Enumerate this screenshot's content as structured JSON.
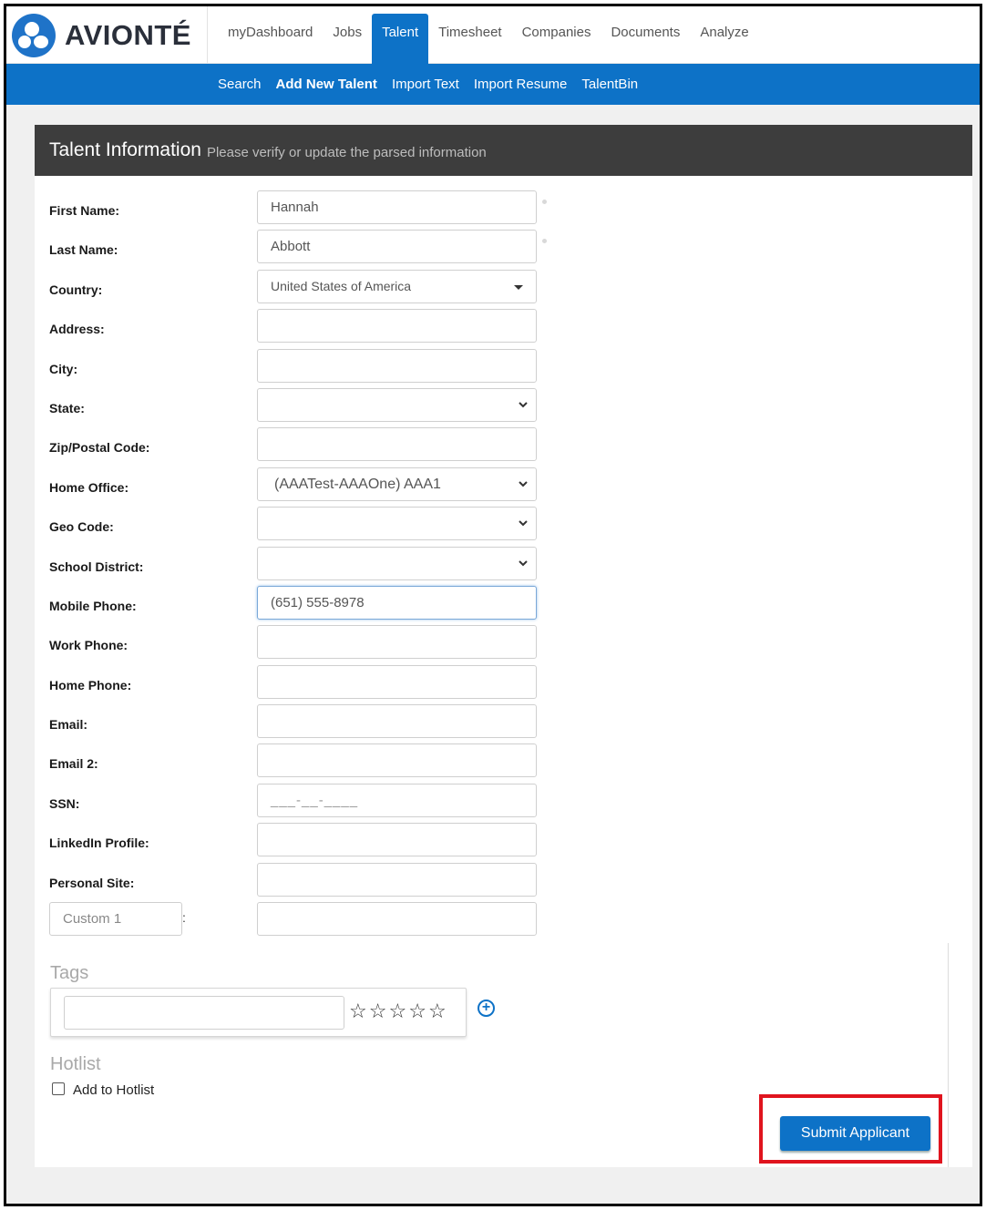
{
  "brand": {
    "name": "AVIONTÉ",
    "logo_icon": "avionte-logo-icon",
    "accent_color": "#0d72c7"
  },
  "top_tabs": [
    {
      "label": "myDashboard",
      "active": false
    },
    {
      "label": "Jobs",
      "active": false
    },
    {
      "label": "Talent",
      "active": true
    },
    {
      "label": "Timesheet",
      "active": false
    },
    {
      "label": "Companies",
      "active": false
    },
    {
      "label": "Documents",
      "active": false
    },
    {
      "label": "Analyze",
      "active": false
    }
  ],
  "sub_nav": [
    {
      "label": "Search",
      "bold": false
    },
    {
      "label": "Add New Talent",
      "bold": true
    },
    {
      "label": "Import Text",
      "bold": false
    },
    {
      "label": "Import Resume",
      "bold": false
    },
    {
      "label": "TalentBin",
      "bold": false
    }
  ],
  "panel": {
    "title": "Talent Information",
    "subtitle": "Please verify or update the parsed information"
  },
  "form": {
    "first_name": {
      "label": "First Name:",
      "value": "Hannah"
    },
    "last_name": {
      "label": "Last Name:",
      "value": "Abbott"
    },
    "country": {
      "label": "Country:",
      "value": "United States of America"
    },
    "address": {
      "label": "Address:",
      "value": ""
    },
    "city": {
      "label": "City:",
      "value": ""
    },
    "state": {
      "label": "State:",
      "value": ""
    },
    "zip": {
      "label": "Zip/Postal Code:",
      "value": ""
    },
    "home_office": {
      "label": "Home Office:",
      "value": "(AAATest-AAAOne) AAA1"
    },
    "geo_code": {
      "label": "Geo Code:",
      "value": ""
    },
    "school_district": {
      "label": "School District:",
      "value": ""
    },
    "mobile_phone": {
      "label": "Mobile Phone:",
      "value": "(651) 555-8978"
    },
    "work_phone": {
      "label": "Work Phone:",
      "value": ""
    },
    "home_phone": {
      "label": "Home Phone:",
      "value": ""
    },
    "email": {
      "label": "Email:",
      "value": ""
    },
    "email2": {
      "label": "Email 2:",
      "value": ""
    },
    "ssn": {
      "label": "SSN:",
      "placeholder": "___-__-____"
    },
    "linkedin": {
      "label": "LinkedIn Profile:",
      "value": ""
    },
    "personal_site": {
      "label": "Personal Site:",
      "value": ""
    },
    "custom1": {
      "placeholder": "Custom 1",
      "colon": ":",
      "value": ""
    }
  },
  "tags": {
    "title": "Tags",
    "stars": [
      "☆",
      "☆",
      "☆",
      "☆",
      "☆"
    ],
    "add_icon": "plus-circle-icon",
    "add_symbol": "+"
  },
  "hotlist": {
    "title": "Hotlist",
    "checkbox_label": "Add to Hotlist",
    "checked": false
  },
  "submit": {
    "label": "Submit Applicant",
    "highlight_color": "#e0141e"
  }
}
